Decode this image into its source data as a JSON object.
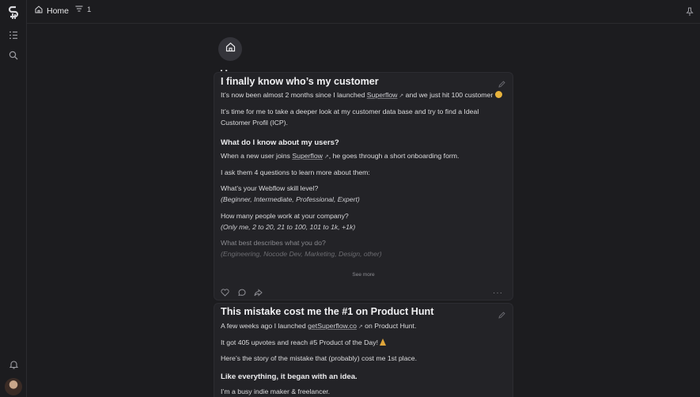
{
  "topbar": {
    "home_label": "Home",
    "filter_count": "1"
  },
  "page": {
    "title_peek": "Home"
  },
  "posts": [
    {
      "title": "I finally know who’s my customer",
      "p1_a": "It’s now been almost 2 months since I launched ",
      "p1_link": "Superflow",
      "p1_b": " and we just hit 100 customer",
      "p2_l1": "It’s time for me to take a deeper look at my customer data base and try to find a Ideal",
      "p2_l2": "Customer Profil (ICP).",
      "h3": "What do I know about my users?",
      "p3_a": "When a new user joins ",
      "p3_link": "Superflow",
      "p3_b": ", he goes through a short onboarding form.",
      "p4": "I ask them 4 questions to learn more about them:",
      "q1": "What’s your Webflow skill level?",
      "a1": "(Beginner, Intermediate, Professional, Expert)",
      "q2": "How many people work at your company?",
      "a2": "(Only me, 2 to 20, 21 to 100, 101 to 1k, +1k)",
      "q3": "What best describes what you do?",
      "a3": "(Engineering, Nocode Dev, Marketing, Design, other)",
      "see_more": "See more"
    },
    {
      "title": "This mistake cost me the #1 on Product Hunt",
      "p1_a": "A few weeks ago I launched ",
      "p1_link": "getSuperflow.co",
      "p1_b": " on Product Hunt.",
      "p2": "It got 405 upvotes and reach #5 Product of the Day!",
      "p3": "Here’s the story of the mistake that (probably) cost me 1st place.",
      "h3": "Like everything, it began with an idea.",
      "p4": "I’m a busy indie maker & freelancer."
    }
  ],
  "icons": {
    "logo": "superflow-logo",
    "sidebar": [
      "list-icon",
      "search-icon",
      "bell-icon"
    ],
    "topbar": [
      "home-icon",
      "filter-icon",
      "pin-icon"
    ],
    "actions": [
      "heart-icon",
      "comment-icon",
      "share-icon",
      "more-icon"
    ]
  },
  "colors": {
    "background": "#1c1c1f",
    "card": "#232327",
    "text": "#e6e6e8"
  }
}
